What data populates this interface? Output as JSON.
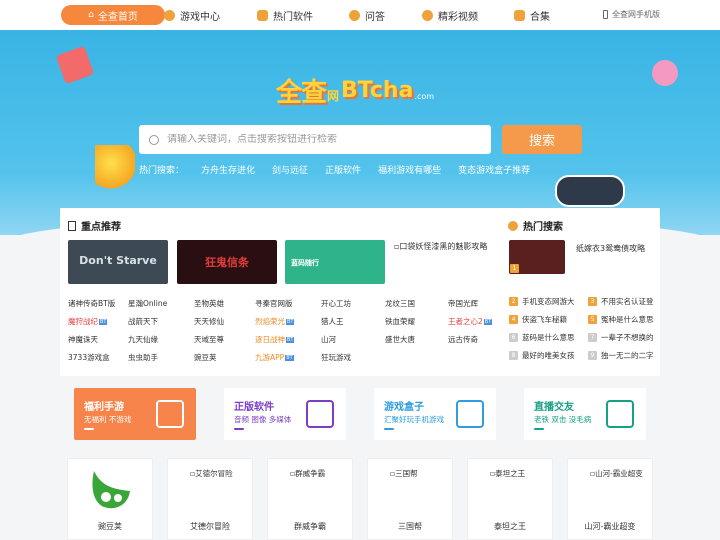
{
  "nav": {
    "home": "全查首页",
    "items": [
      "游戏中心",
      "热门软件",
      "问答",
      "精彩视频",
      "合集"
    ],
    "mobile": "全查网手机版"
  },
  "hero": {
    "logo_cn": "全查",
    "logo_wang": "网",
    "logo_en": "BTcha",
    "logo_com": ".com",
    "search_placeholder": "请输入关键词，点击搜索按钮进行检索",
    "search_button": "搜索",
    "hot_label": "热门搜索：",
    "hot_terms": [
      "方舟生存进化",
      "剑与远征",
      "正版软件",
      "福利游戏有哪些",
      "变态游戏盒子推荐"
    ]
  },
  "featured": {
    "title": "重点推荐",
    "thumbs": [
      {
        "label": "Don't Starve",
        "bg": "#3d4a55",
        "fg": "#d9e0e6"
      },
      {
        "label": "狂鬼信条",
        "bg": "#2a0f12",
        "fg": "#e23b3b"
      },
      {
        "label": "蓝码随行",
        "bg": "#2fb38a",
        "fg": "#ffffff"
      }
    ],
    "broken_thumb": "口袋妖怪漆黑的魅影攻略",
    "links": [
      [
        {
          "t": "诸神传奇BT版",
          "c": ""
        },
        {
          "t": "星瀚Online",
          "c": ""
        },
        {
          "t": "圣物英雄",
          "c": ""
        },
        {
          "t": "寻秦官网版",
          "c": ""
        },
        {
          "t": "开心工坊",
          "c": ""
        },
        {
          "t": "龙纹三国",
          "c": ""
        },
        {
          "t": "帝国光辉",
          "c": ""
        }
      ],
      [
        {
          "t": "魔狩战纪",
          "c": "red",
          "b": "BT"
        },
        {
          "t": "战箭天下",
          "c": ""
        },
        {
          "t": "天天修仙",
          "c": ""
        },
        {
          "t": "烈焰荣光",
          "c": "orange",
          "b": "BT"
        },
        {
          "t": "猎人王",
          "c": ""
        },
        {
          "t": "铁血荣耀",
          "c": ""
        },
        {
          "t": "王者之心2",
          "c": "red",
          "b": "BT"
        }
      ],
      [
        {
          "t": "神魔诛天",
          "c": ""
        },
        {
          "t": "九天仙缘",
          "c": ""
        },
        {
          "t": "天域至尊",
          "c": ""
        },
        {
          "t": "逐日战神",
          "c": "orange",
          "b": "BT"
        },
        {
          "t": "山河",
          "c": ""
        },
        {
          "t": "盛世大唐",
          "c": ""
        },
        {
          "t": "远古传奇",
          "c": ""
        }
      ],
      [
        {
          "t": "3733游戏盒",
          "c": ""
        },
        {
          "t": "虫虫助手",
          "c": ""
        },
        {
          "t": "豌豆荚",
          "c": ""
        },
        {
          "t": "九游APP",
          "c": "orange",
          "b": "BT"
        },
        {
          "t": "狂玩游戏",
          "c": ""
        }
      ]
    ]
  },
  "hot": {
    "title": "热门搜索",
    "top_title": "纸嫁衣3鸳鸯债攻略",
    "items": [
      [
        "手机变态网游大",
        "不用实名认证登"
      ],
      [
        "侠盗飞车秘籍",
        "冤种是什么意思"
      ],
      [
        "蓝码是什么意思",
        "一辈子不想换的"
      ],
      [
        "最好的唯美女孩",
        "独一无二的二字"
      ]
    ]
  },
  "tiles": [
    {
      "title": "福利手游",
      "sub": "无福利 不游戏",
      "bg": "#f7844a",
      "color": "#ffffff",
      "bar": "#ffffff"
    },
    {
      "title": "正版软件",
      "sub": "音频 图像 多媒体",
      "bg": "#ffffff",
      "color": "#7b3fc7",
      "bar": "#7b3fc7"
    },
    {
      "title": "游戏盒子",
      "sub": "汇聚好玩手机游戏",
      "bg": "#ffffff",
      "color": "#2f9de0",
      "bar": "#2f9de0"
    },
    {
      "title": "直播交友",
      "sub": "老铁 双击 没毛病",
      "bg": "#ffffff",
      "color": "#16a085",
      "bar": "#16a085"
    }
  ],
  "games": [
    {
      "alt": "",
      "name": "豌豆荚"
    },
    {
      "alt": "艾德尔冒险",
      "name": "艾德尔冒险"
    },
    {
      "alt": "群威争霸",
      "name": "群威争霸"
    },
    {
      "alt": "三国帮",
      "name": "三国帮"
    },
    {
      "alt": "泰坦之王",
      "name": "泰坦之王"
    },
    {
      "alt": "山河-霸业超变",
      "name": "山河-霸业超变"
    }
  ]
}
